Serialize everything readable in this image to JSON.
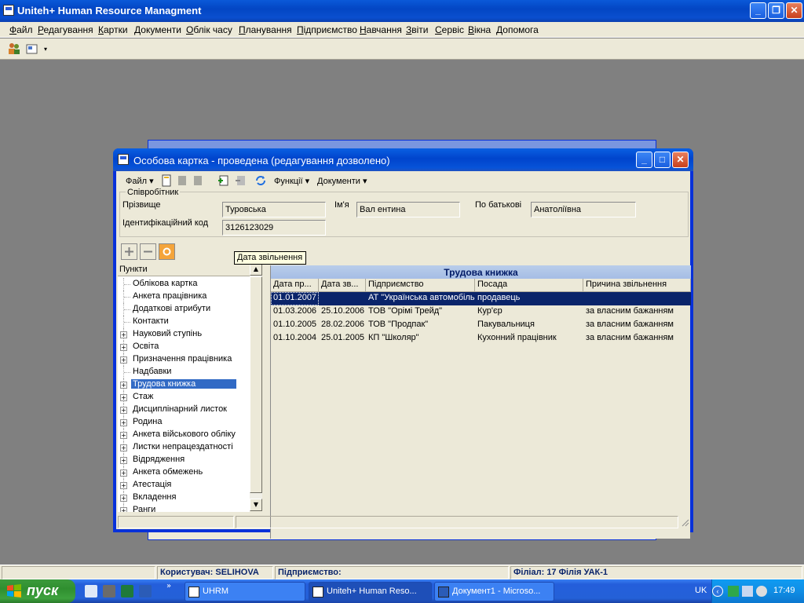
{
  "app": {
    "title": "Uniteh+ Human Resource Managment",
    "menu": [
      "Файл",
      "Редагування",
      "Картки",
      "Документи",
      "Облік часу",
      "Планування",
      "Підприємство",
      "Навчання",
      "Звіти",
      "Сервіс",
      "Вікна",
      "Допомога"
    ]
  },
  "dialog": {
    "title": "Особова картка - проведена (редагування дозволено)",
    "toolbar": {
      "file": "Файл",
      "functions": "Функції",
      "documents": "Документи"
    },
    "employee": {
      "group_label": "Співробітник",
      "surname_label": "Прізвище",
      "surname": "Туровська",
      "name_label": "Ім'я",
      "name": "Вал ентина",
      "patronymic_label": "По батькові",
      "patronymic": "Анатоліївна",
      "id_label": "Ідентифікаційний код",
      "id_code": "3126123029"
    },
    "tree": {
      "header": "Пункти",
      "items": [
        {
          "label": "Облікова картка",
          "expandable": false
        },
        {
          "label": "Анкета працівника",
          "expandable": false
        },
        {
          "label": "Додаткові атрибути",
          "expandable": false
        },
        {
          "label": "Контакти",
          "expandable": false
        },
        {
          "label": "Науковий ступінь",
          "expandable": true
        },
        {
          "label": "Освіта",
          "expandable": true
        },
        {
          "label": "Призначення працівника",
          "expandable": true
        },
        {
          "label": "Надбавки",
          "expandable": false
        },
        {
          "label": "Трудова книжка",
          "expandable": true,
          "selected": true
        },
        {
          "label": "Стаж",
          "expandable": true
        },
        {
          "label": "Дисциплінарний листок",
          "expandable": true
        },
        {
          "label": "Родина",
          "expandable": true
        },
        {
          "label": "Анкета військового обліку",
          "expandable": true
        },
        {
          "label": "Листки непрацездатності",
          "expandable": true
        },
        {
          "label": "Відрядження",
          "expandable": true
        },
        {
          "label": "Анкета обмежень",
          "expandable": true
        },
        {
          "label": "Атестація",
          "expandable": true
        },
        {
          "label": "Вкладення",
          "expandable": true
        },
        {
          "label": "Ранги",
          "expandable": true
        }
      ]
    },
    "grid": {
      "caption": "Трудова книжка",
      "columns": [
        "Дата пр...",
        "Дата зв...",
        "Підприємство",
        "Посада",
        "Причина звільнення"
      ],
      "rows": [
        [
          "01.01.2007",
          "",
          "АТ \"Українська автомобільна корпорація\"",
          "продавець",
          ""
        ],
        [
          "01.03.2006",
          "25.10.2006",
          "ТОВ \"Орімі Трейд\"",
          "Кур'єр",
          "за власним бажанням"
        ],
        [
          "01.10.2005",
          "28.02.2006",
          "ТОВ \"Продпак\"",
          "Пакувальниця",
          "за власним бажанням"
        ],
        [
          "01.10.2004",
          "25.01.2005",
          "КП \"Школяр\"",
          "Кухонний працівник",
          "за власним бажанням"
        ]
      ],
      "selected_row": 0,
      "tooltip": "Дата звільнення"
    }
  },
  "status": {
    "user": "Користувач: SELIHOVA",
    "enterprise": "Підприємство:",
    "branch": "Філіал: 17 Філія УАК-1"
  },
  "taskbar": {
    "start": "пуск",
    "tasks": [
      "UHRM",
      "Uniteh+ Human Reso...",
      "Документ1 - Microso..."
    ],
    "lang": "UK",
    "clock": "17:49"
  }
}
